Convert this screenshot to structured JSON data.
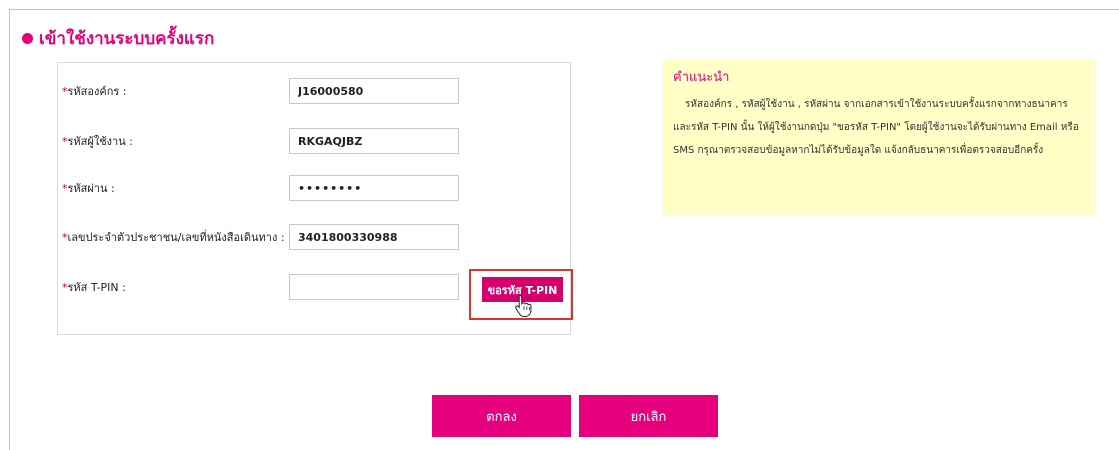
{
  "page": {
    "title": "เข้าใช้งานระบบครั้งแรก"
  },
  "form": {
    "required_mark": "*",
    "fields": [
      {
        "label": "รหัสองค์กร :",
        "value": "J16000580",
        "type": "text"
      },
      {
        "label": "รหัสผู้ใช้งาน :",
        "value": "RKGAQJBZ",
        "type": "text"
      },
      {
        "label": "รหัสผ่าน :",
        "value": "••••••••",
        "type": "password"
      },
      {
        "label": "เลขประจำตัวประชาชน/เลขที่หนังสือเดินทาง :",
        "value": "3401800330988",
        "type": "text"
      },
      {
        "label": "รหัส T-PIN :",
        "value": "",
        "type": "text"
      }
    ],
    "request_tpin_label": "ขอรหัส T-PIN"
  },
  "hint": {
    "title": "คำแนะนำ",
    "body": "รหัสองค์กร , รหัสผู้ใช้งาน , รหัสผ่าน จากเอกสารเข้าใช้งานระบบครั้งแรกจากทางธนาคาร และรหัส T-PIN นั้น ให้ผู้ใช้งานกดปุ่ม \"ขอรหัส T-PIN\" โดยผู้ใช้งานจะได้รับผ่านทาง Email หรือ SMS กรุณาตรวจสอบข้อมูลหากไม่ได้รับข้อมูลใด แจ้งกลับธนาคารเพื่อตรวจสอบอีกครั้ง"
  },
  "actions": {
    "ok_label": "ตกลง",
    "cancel_label": "ยกเลิก"
  },
  "colors": {
    "accent": "#e6007e",
    "hint_bg": "#ffffc6",
    "highlight": "#e03030"
  },
  "icons": {
    "title_bullet": "bullet-dot-icon",
    "cursor": "hand-pointer-icon"
  }
}
